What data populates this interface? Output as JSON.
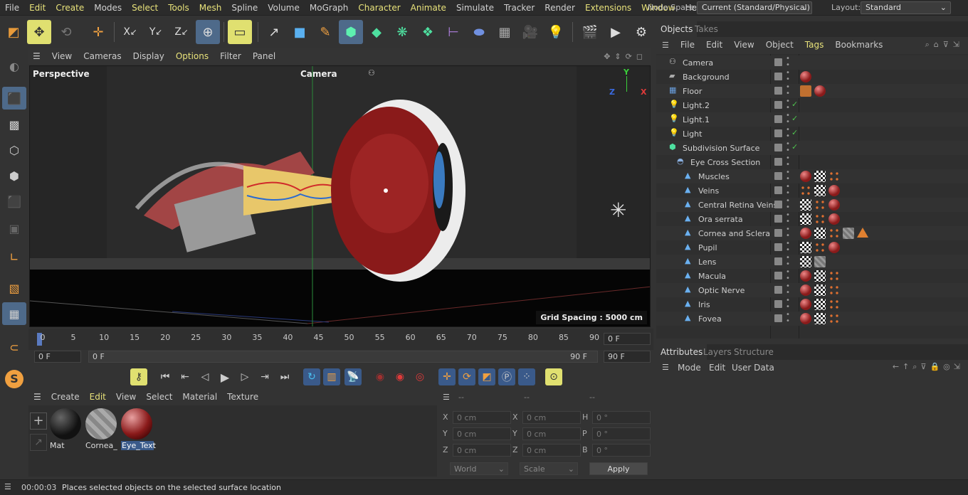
{
  "menu": [
    "File",
    "Edit",
    "Create",
    "Modes",
    "Select",
    "Tools",
    "Mesh",
    "Spline",
    "Volume",
    "MoGraph",
    "Character",
    "Animate",
    "Simulate",
    "Tracker",
    "Render",
    "Extensions",
    "Window",
    "Help"
  ],
  "node_space_label": "Node Space:",
  "node_space_value": "Current (Standard/Physical)",
  "layout_label": "Layout:",
  "layout_value": "Standard",
  "viewport": {
    "menu": [
      "View",
      "Cameras",
      "Display",
      "Options",
      "Filter",
      "Panel"
    ],
    "view_name": "Perspective",
    "camera_name": "Camera",
    "grid_spacing": "Grid Spacing : 5000 cm",
    "axis_y": "Y",
    "axis_x": "X",
    "axis_z": "Z"
  },
  "timeline": {
    "ticks": [
      "0",
      "5",
      "10",
      "15",
      "20",
      "25",
      "30",
      "35",
      "40",
      "45",
      "50",
      "55",
      "60",
      "65",
      "70",
      "75",
      "80",
      "85",
      "90"
    ],
    "current_frame_right": "0 F",
    "start_frame": "0 F",
    "range_start": "0 F",
    "range_end": "90 F",
    "end_frame": "90 F"
  },
  "material_menu": [
    "Create",
    "Edit",
    "View",
    "Select",
    "Material",
    "Texture"
  ],
  "materials": [
    {
      "name": "Mat"
    },
    {
      "name": "Cornea_"
    },
    {
      "name": "Eye_Text"
    }
  ],
  "coords": {
    "header": [
      "--",
      "--",
      "--"
    ],
    "rows": [
      {
        "l1": "X",
        "v1": "0 cm",
        "l2": "X",
        "v2": "0 cm",
        "l3": "H",
        "v3": "0 °"
      },
      {
        "l1": "Y",
        "v1": "0 cm",
        "l2": "Y",
        "v2": "0 cm",
        "l3": "P",
        "v3": "0 °"
      },
      {
        "l1": "Z",
        "v1": "0 cm",
        "l2": "Z",
        "v2": "0 cm",
        "l3": "B",
        "v3": "0 °"
      }
    ],
    "world": "World",
    "scale": "Scale",
    "apply": "Apply"
  },
  "objects_panel": {
    "tabs": [
      "Objects",
      "Takes"
    ],
    "menu": [
      "File",
      "Edit",
      "View",
      "Object",
      "Tags",
      "Bookmarks"
    ],
    "items": [
      {
        "name": "Camera",
        "indent": 0,
        "check": false
      },
      {
        "name": "Background",
        "indent": 0,
        "check": false
      },
      {
        "name": "Floor",
        "indent": 0,
        "check": false
      },
      {
        "name": "Light.2",
        "indent": 0,
        "check": true
      },
      {
        "name": "Light.1",
        "indent": 0,
        "check": true
      },
      {
        "name": "Light",
        "indent": 0,
        "check": true
      },
      {
        "name": "Subdivision Surface",
        "indent": 0,
        "check": true
      },
      {
        "name": "Eye Cross Section",
        "indent": 1,
        "check": false
      },
      {
        "name": "Muscles",
        "indent": 2,
        "check": false
      },
      {
        "name": "Veins",
        "indent": 2,
        "check": false
      },
      {
        "name": "Central Retina Veins",
        "indent": 2,
        "check": false
      },
      {
        "name": "Ora serrata",
        "indent": 2,
        "check": false
      },
      {
        "name": "Cornea and Sclera",
        "indent": 2,
        "check": false
      },
      {
        "name": "Pupil",
        "indent": 2,
        "check": false
      },
      {
        "name": "Lens",
        "indent": 2,
        "check": false
      },
      {
        "name": "Macula",
        "indent": 2,
        "check": false
      },
      {
        "name": "Optic Nerve",
        "indent": 2,
        "check": false
      },
      {
        "name": "Iris",
        "indent": 2,
        "check": false
      },
      {
        "name": "Fovea",
        "indent": 2,
        "check": false
      }
    ]
  },
  "attributes_panel": {
    "tabs": [
      "Attributes",
      "Layers",
      "Structure"
    ],
    "menu": [
      "Mode",
      "Edit",
      "User Data"
    ]
  },
  "status": {
    "time": "00:00:03",
    "message": "Places selected objects on the selected surface location"
  },
  "colors": {
    "accent_yellow": "#e8e27a",
    "selected_blue": "#4e6a8a",
    "check_green": "#4fc24f"
  }
}
